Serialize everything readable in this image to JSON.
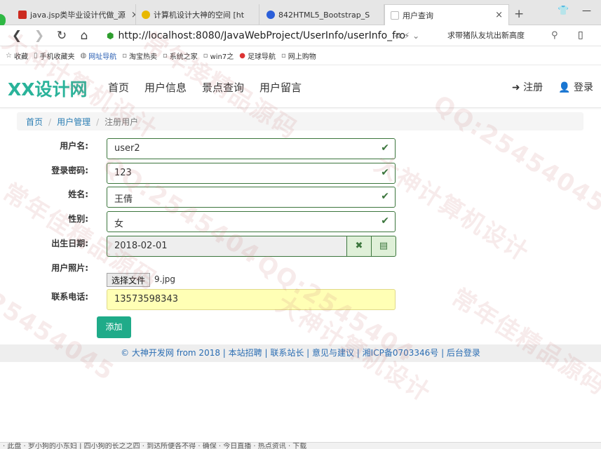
{
  "browser": {
    "tabs": [
      {
        "label": "java.jsp类毕业设计代做_源",
        "favicon_color": "#cc2a1f"
      },
      {
        "label": "计算机设计大神的空间 [ht",
        "favicon_color": "#e8b800"
      },
      {
        "label": "842HTML5_Bootstrap_S",
        "favicon_color": "#2b5fd9"
      },
      {
        "label": "用户查询",
        "favicon_color": "#dddddd"
      }
    ],
    "tab_close": "×",
    "new_tab": "+",
    "url": "http://localhost:8080/JavaWebProject/UserInfo/userInfo_fro",
    "search_text": "求带猪队友坑出新高度",
    "bookmarks": [
      "收藏",
      "手机收藏夹",
      "网址导航",
      "淘宝热卖",
      "系统之家",
      "win7之",
      "足球导航",
      "网上购物"
    ]
  },
  "site": {
    "brand": "XX设计网",
    "nav": [
      "首页",
      "用户信息",
      "景点查询",
      "用户留言"
    ],
    "register": "注册",
    "login": "登录",
    "brand_color": "#2ab39a"
  },
  "breadcrumb": {
    "home": "首页",
    "section": "用户管理",
    "current": "注册用户"
  },
  "form": {
    "username_label": "用户名:",
    "username": "user2",
    "password_label": "登录密码:",
    "password": "123",
    "name_label": "姓名:",
    "name": "王倩",
    "gender_label": "性别:",
    "gender": "女",
    "birthday_label": "出生日期:",
    "birthday": "2018-02-01",
    "photo_label": "用户照片:",
    "file_button": "选择文件",
    "file_name": "9.jpg",
    "phone_label": "联系电话:",
    "phone": "13573598343",
    "submit": "添加"
  },
  "footer": {
    "text": "© 大神开发网 from 2018 | 本站招聘 | 联系站长 | 意见与建议 | 湘ICP备0703346号 | 后台登录"
  },
  "watermarks": [
    "大神计算机设计",
    "QQ:25454045",
    "常年接精品源码",
    "QQ:2545404",
    "大神计算机设计",
    "QQ:2545404",
    "常年佳精品源码",
    "25454045",
    "大神计算机设计",
    "常年佳精品源码"
  ],
  "statusbar": "· 此盘 · 罗小狗的小东妇 | 四小狗的长之之四 · 到达所便各不得 · 确保 · 今日直播 · 热点资讯 · 下载"
}
